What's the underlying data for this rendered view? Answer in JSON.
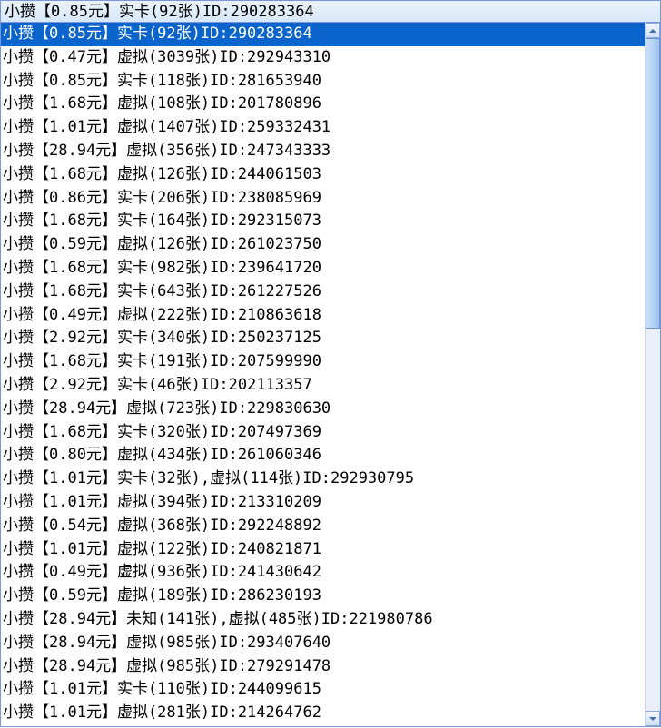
{
  "combo": {
    "selected_text": "小攒【0.85元】实卡(92张)ID:290283364",
    "selected_index": 0
  },
  "items": [
    {
      "text": "小攒【0.85元】实卡(92张)ID:290283364"
    },
    {
      "text": "小攒【0.47元】虚拟(3039张)ID:292943310"
    },
    {
      "text": "小攒【0.85元】实卡(118张)ID:281653940"
    },
    {
      "text": "小攒【1.68元】虚拟(108张)ID:201780896"
    },
    {
      "text": "小攒【1.01元】虚拟(1407张)ID:259332431"
    },
    {
      "text": "小攒【28.94元】虚拟(356张)ID:247343333"
    },
    {
      "text": "小攒【1.68元】虚拟(126张)ID:244061503"
    },
    {
      "text": "小攒【0.86元】实卡(206张)ID:238085969"
    },
    {
      "text": "小攒【1.68元】实卡(164张)ID:292315073"
    },
    {
      "text": "小攒【0.59元】虚拟(126张)ID:261023750"
    },
    {
      "text": "小攒【1.68元】实卡(982张)ID:239641720"
    },
    {
      "text": "小攒【1.68元】实卡(643张)ID:261227526"
    },
    {
      "text": "小攒【0.49元】虚拟(222张)ID:210863618"
    },
    {
      "text": "小攒【2.92元】实卡(340张)ID:250237125"
    },
    {
      "text": "小攒【1.68元】实卡(191张)ID:207599990"
    },
    {
      "text": "小攒【2.92元】实卡(46张)ID:202113357"
    },
    {
      "text": "小攒【28.94元】虚拟(723张)ID:229830630"
    },
    {
      "text": "小攒【1.68元】实卡(320张)ID:207497369"
    },
    {
      "text": "小攒【0.80元】虚拟(434张)ID:261060346"
    },
    {
      "text": "小攒【1.01元】实卡(32张),虚拟(114张)ID:292930795"
    },
    {
      "text": "小攒【1.01元】虚拟(394张)ID:213310209"
    },
    {
      "text": "小攒【0.54元】虚拟(368张)ID:292248892"
    },
    {
      "text": "小攒【1.01元】虚拟(122张)ID:240821871"
    },
    {
      "text": "小攒【0.49元】虚拟(936张)ID:241430642"
    },
    {
      "text": "小攒【0.59元】虚拟(189张)ID:286230193"
    },
    {
      "text": "小攒【28.94元】未知(141张),虚拟(485张)ID:221980786"
    },
    {
      "text": "小攒【28.94元】虚拟(985张)ID:293407640"
    },
    {
      "text": "小攒【28.94元】虚拟(985张)ID:279291478"
    },
    {
      "text": "小攒【1.01元】实卡(110张)ID:244099615"
    },
    {
      "text": "小攒【1.01元】虚拟(281张)ID:214264762"
    }
  ]
}
